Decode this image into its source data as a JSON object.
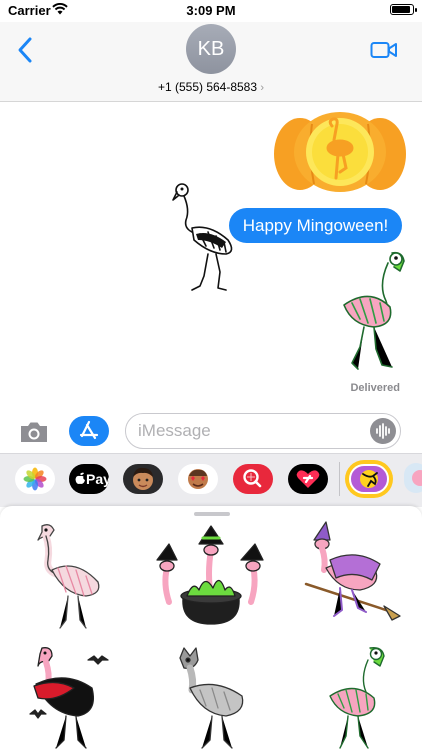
{
  "status_bar": {
    "carrier": "Carrier",
    "time": "3:09 PM"
  },
  "header": {
    "avatar_initials": "KB",
    "contact": "+1 (555) 564-8583",
    "chevron": "›"
  },
  "messages": {
    "bubble_text": "Happy Mingoween!",
    "delivered": "Delivered"
  },
  "composer": {
    "placeholder": "iMessage"
  },
  "drawer": {
    "apple_pay_label": "Pay"
  },
  "colors": {
    "accent_blue": "#1b86f6",
    "pumpkin": "#f7a023",
    "flamingo_pink": "#f7a5c0",
    "slime_green": "#6cdb3f"
  },
  "icons": [
    "back-chevron-icon",
    "video-camera-icon",
    "camera-icon",
    "app-store-icon",
    "audio-waveform-icon",
    "photos-app-icon",
    "apple-pay-icon",
    "memoji-icon",
    "emoji-stickers-icon",
    "images-search-icon",
    "digital-touch-icon",
    "flamingo-sticker-app-icon"
  ]
}
